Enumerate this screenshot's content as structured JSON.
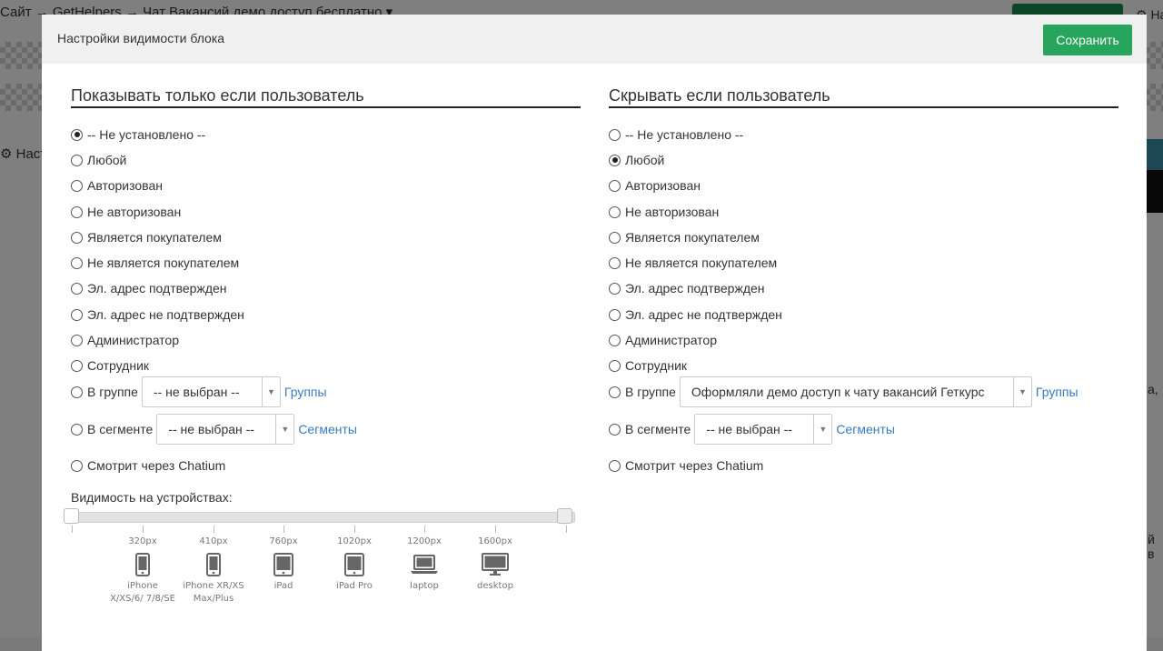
{
  "background": {
    "breadcrumb": "Сайт → GetHelpers → Чат Вакансий демо доступ бесплатно ▾",
    "right_link": "⚙ На",
    "settings_link": "⚙ Наст",
    "frag1": "а,",
    "frag2": "й в"
  },
  "modal": {
    "title": "Настройки видимости блока",
    "save_label": "Сохранить"
  },
  "left": {
    "title": "Показывать только если пользователь",
    "options": [
      {
        "label": "-- Не установлено --",
        "checked": true
      },
      {
        "label": "Любой",
        "checked": false
      },
      {
        "label": "Авторизован",
        "checked": false
      },
      {
        "label": "Не авторизован",
        "checked": false
      },
      {
        "label": "Является покупателем",
        "checked": false
      },
      {
        "label": "Не является покупателем",
        "checked": false
      },
      {
        "label": "Эл. адрес подтвержден",
        "checked": false
      },
      {
        "label": "Эл. адрес не подтвержден",
        "checked": false
      },
      {
        "label": "Администратор",
        "checked": false
      },
      {
        "label": "Сотрудник",
        "checked": false
      }
    ],
    "group": {
      "label": "В группе",
      "value": "-- не выбран --",
      "link": "Группы",
      "checked": false
    },
    "segment": {
      "label": "В сегменте",
      "value": "-- не выбран --",
      "link": "Сегменты",
      "checked": false
    },
    "chatium": {
      "label": "Смотрит через Chatium",
      "checked": false
    }
  },
  "right": {
    "title": "Скрывать если пользователь",
    "options": [
      {
        "label": "-- Не установлено --",
        "checked": false
      },
      {
        "label": "Любой",
        "checked": true
      },
      {
        "label": "Авторизован",
        "checked": false
      },
      {
        "label": "Не авторизован",
        "checked": false
      },
      {
        "label": "Является покупателем",
        "checked": false
      },
      {
        "label": "Не является покупателем",
        "checked": false
      },
      {
        "label": "Эл. адрес подтвержден",
        "checked": false
      },
      {
        "label": "Эл. адрес не подтвержден",
        "checked": false
      },
      {
        "label": "Администратор",
        "checked": false
      },
      {
        "label": "Сотрудник",
        "checked": false
      }
    ],
    "group": {
      "label": "В группе",
      "value": "Оформляли демо доступ к чату вакансий Геткурс",
      "link": "Группы",
      "checked": false
    },
    "segment": {
      "label": "В сегменте",
      "value": "-- не выбран --",
      "link": "Сегменты",
      "checked": false
    },
    "chatium": {
      "label": "Смотрит через Chatium",
      "checked": false
    }
  },
  "visibility": {
    "label": "Видимость на устройствах:",
    "devices": [
      {
        "px": "320px",
        "icon": "phone-icon",
        "name": "iPhone X/XS/6/ 7/8/SE"
      },
      {
        "px": "410px",
        "icon": "phone-icon",
        "name": "iPhone XR/XS Max/Plus"
      },
      {
        "px": "760px",
        "icon": "tablet-icon",
        "name": "iPad"
      },
      {
        "px": "1020px",
        "icon": "tablet-icon",
        "name": "iPad Pro"
      },
      {
        "px": "1200px",
        "icon": "laptop-icon",
        "name": "laptop"
      },
      {
        "px": "1600px",
        "icon": "desktop-icon",
        "name": "desktop"
      }
    ]
  }
}
